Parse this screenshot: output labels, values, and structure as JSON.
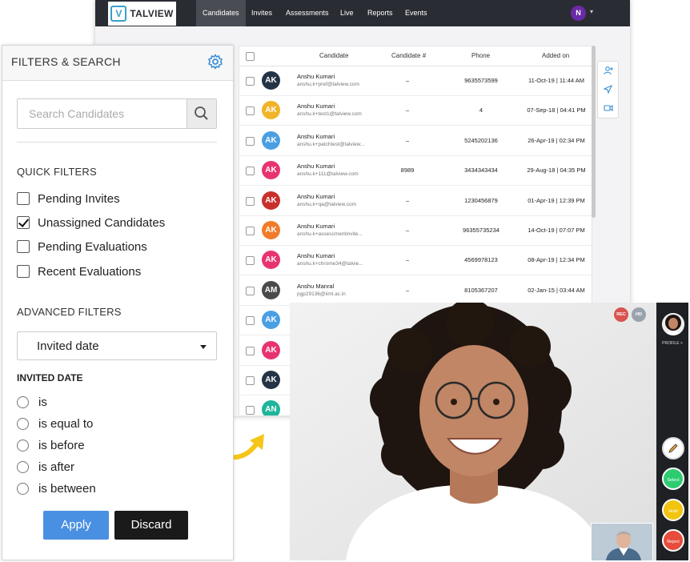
{
  "app": {
    "brand": "TALVIEW",
    "nav": [
      "Candidates",
      "Invites",
      "Assessments",
      "Live",
      "Reports",
      "Events"
    ],
    "active_nav": "Candidates",
    "user_initial": "N"
  },
  "table": {
    "headers": {
      "candidate": "Candidate",
      "candidate_no": "Candidate #",
      "phone": "Phone",
      "added_on": "Added on"
    },
    "rows": [
      {
        "initials": "AK",
        "color": "#243447",
        "name": "Anshu Kumari",
        "email": "anshu.k+pref@talview.com",
        "cand_no": "–",
        "phone": "9635573599",
        "date": "11-Oct-19 | 11:44 AM"
      },
      {
        "initials": "AK",
        "color": "#f0b429",
        "name": "Anshu Kumari",
        "email": "anshu.k+test1@talview.com",
        "cand_no": "–",
        "phone": "4",
        "date": "07-Sep-18 | 04:41 PM"
      },
      {
        "initials": "AK",
        "color": "#4a9fe3",
        "name": "Anshu Kumari",
        "email": "anshu.k+patchtest@talview...",
        "cand_no": "–",
        "phone": "5245202136",
        "date": "26-Apr-19 | 02:34 PM"
      },
      {
        "initials": "AK",
        "color": "#e8336f",
        "name": "Anshu Kumari",
        "email": "anshu.k+111@talview.com",
        "cand_no": "8989",
        "phone": "3434343434",
        "date": "29-Aug-18 | 04:35 PM"
      },
      {
        "initials": "AK",
        "color": "#c9302c",
        "name": "Anshu Kumari",
        "email": "anshu.k+qa@talview.com",
        "cand_no": "–",
        "phone": "1230456879",
        "date": "01-Apr-19 | 12:39 PM"
      },
      {
        "initials": "AK",
        "color": "#f07b2a",
        "name": "Anshu Kumari",
        "email": "anshu.k+assessmentinvite...",
        "cand_no": "–",
        "phone": "96355735234",
        "date": "14-Oct-19 | 07:07 PM"
      },
      {
        "initials": "AK",
        "color": "#e8336f",
        "name": "Anshu Kumari",
        "email": "anshu.k+chrome34@talvie...",
        "cand_no": "–",
        "phone": "4569978123",
        "date": "08-Apr-19 | 12:34 PM"
      },
      {
        "initials": "AM",
        "color": "#4a4a4a",
        "name": "Anshu Manral",
        "email": "pgp29136@iiml.ac.in",
        "cand_no": "–",
        "phone": "8105367207",
        "date": "02-Jan-15 | 03:44 AM"
      },
      {
        "initials": "AK",
        "color": "#4a9fe3",
        "name": "",
        "email": "",
        "cand_no": "",
        "phone": "",
        "date": ""
      },
      {
        "initials": "AK",
        "color": "#e8336f",
        "name": "",
        "email": "",
        "cand_no": "",
        "phone": "",
        "date": ""
      },
      {
        "initials": "AK",
        "color": "#243447",
        "name": "",
        "email": "",
        "cand_no": "",
        "phone": "",
        "date": ""
      },
      {
        "initials": "AN",
        "color": "#1fb59a",
        "name": "",
        "email": "",
        "cand_no": "",
        "phone": "",
        "date": ""
      }
    ]
  },
  "filters": {
    "title": "FILTERS & SEARCH",
    "search_placeholder": "Search Candidates",
    "quick_title": "QUICK FILTERS",
    "quick": [
      {
        "label": "Pending Invites",
        "checked": false
      },
      {
        "label": "Unassigned Candidates",
        "checked": true
      },
      {
        "label": "Pending Evaluations",
        "checked": false
      },
      {
        "label": "Recent Evaluations",
        "checked": false
      }
    ],
    "advanced_title": "ADVANCED FILTERS",
    "date_select": "Invited date",
    "invited_label": "INVITED DATE",
    "radios": [
      "is",
      "is equal to",
      "is before",
      "is after",
      "is between"
    ],
    "apply": "Apply",
    "discard": "Discard"
  },
  "video": {
    "rec": "REC",
    "hd": "HD",
    "profile": "PROFILE >",
    "buttons": [
      {
        "label": "",
        "color": "#ffffff",
        "icon": "pencil-icon"
      },
      {
        "label": "Select",
        "color": "#2ecc71"
      },
      {
        "label": "Hold",
        "color": "#f1c40f"
      },
      {
        "label": "Reject",
        "color": "#e74c3c"
      }
    ]
  }
}
